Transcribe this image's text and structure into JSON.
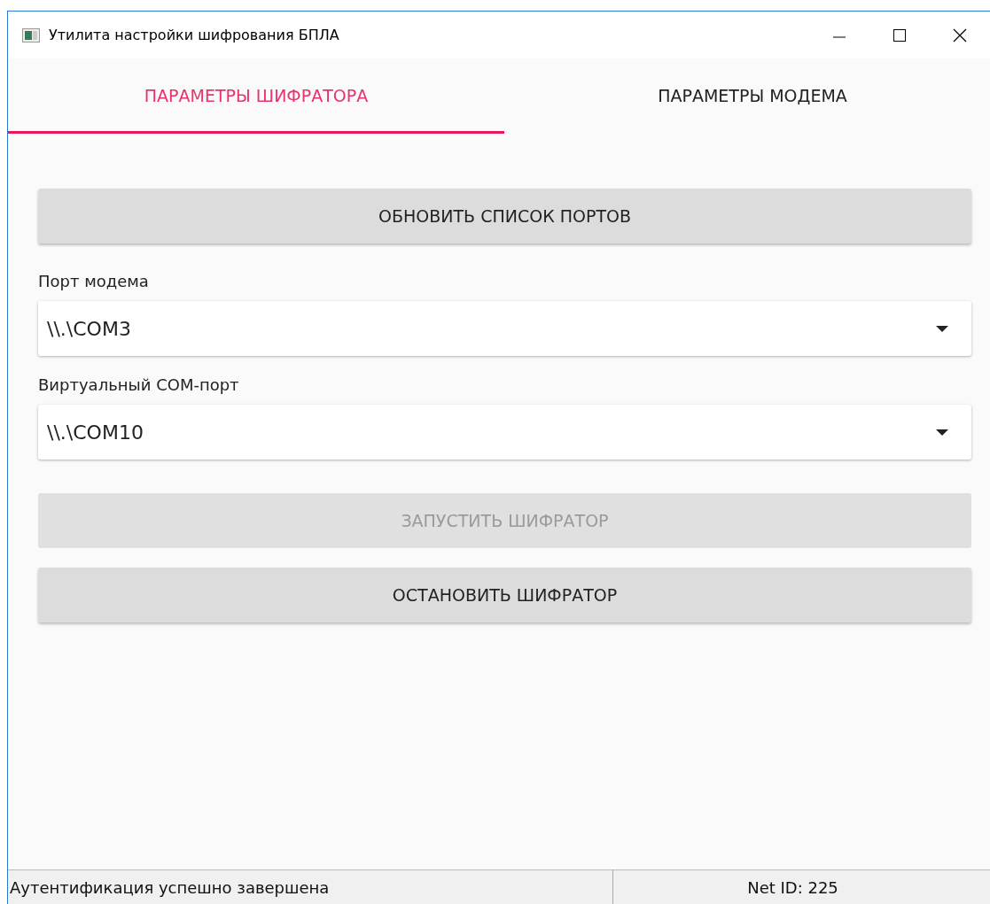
{
  "window": {
    "title": "Утилита настройки шифрования БПЛА"
  },
  "tabs": [
    {
      "label": "ПАРАМЕТРЫ ШИФРАТОРА",
      "selected": true
    },
    {
      "label": "ПАРАМЕТРЫ МОДЕМА",
      "selected": false
    }
  ],
  "form": [
    {
      "kind": "button",
      "label": "ОБНОВИТЬ СПИСОК ПОРТОВ",
      "disabled": false
    },
    {
      "kind": "combo",
      "label": "Порт модема",
      "value": "\\\\.\\COM3"
    },
    {
      "kind": "combo",
      "label": "Виртуальный COM-порт",
      "value": "\\\\.\\COM10"
    },
    {
      "kind": "button",
      "label": "ЗАПУСТИТЬ ШИФРАТОР",
      "disabled": true
    },
    {
      "kind": "button",
      "label": "ОСТАНОВИТЬ ШИФРАТОР",
      "disabled": false
    }
  ],
  "status_bar": {
    "message": "Аутентификация успешно завершена",
    "net_id": "Net ID: 225"
  }
}
